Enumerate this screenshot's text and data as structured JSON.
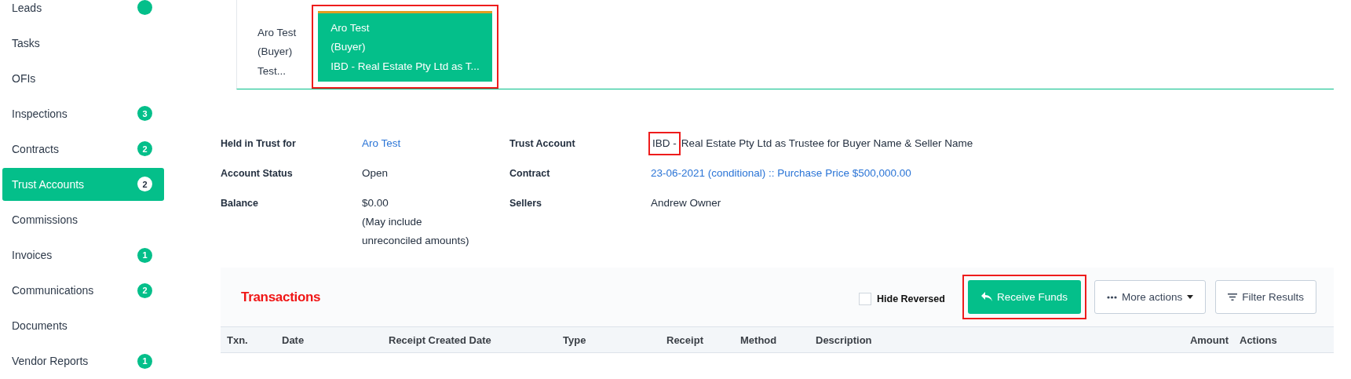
{
  "sidebar": {
    "items": [
      {
        "label": "Leads",
        "selected": false,
        "badge_cut": true
      },
      {
        "label": "Tasks",
        "selected": false
      },
      {
        "label": "OFIs",
        "selected": false
      },
      {
        "label": "Inspections",
        "selected": false,
        "badge": "3"
      },
      {
        "label": "Contracts",
        "selected": false,
        "badge": "2"
      },
      {
        "label": "Trust Accounts",
        "selected": true,
        "badge": "2"
      },
      {
        "label": "Commissions",
        "selected": false
      },
      {
        "label": "Invoices",
        "selected": false,
        "badge": "1"
      },
      {
        "label": "Communications",
        "selected": false,
        "badge": "2"
      },
      {
        "label": "Documents",
        "selected": false
      },
      {
        "label": "Vendor Reports",
        "selected": false,
        "badge": "1"
      }
    ]
  },
  "account_tabs": [
    {
      "lines": [
        "Aro Test",
        "(Buyer)",
        "Test..."
      ],
      "selected": false,
      "highlighted": false
    },
    {
      "lines": [
        "Aro Test",
        "(Buyer)",
        "IBD - Real Estate Pty Ltd as T..."
      ],
      "selected": true,
      "highlighted": true
    }
  ],
  "details": [
    {
      "label": "Held in Trust for",
      "kind": "link",
      "lines": [
        "Aro Test"
      ]
    },
    {
      "label": "Trust Account",
      "kind": "account",
      "prefix": "IBD -",
      "lines": [
        "Real Estate Pty Ltd as Trustee for Buyer Name & Seller Name"
      ],
      "highlighted": true
    },
    {
      "label": "Account Status",
      "kind": "text",
      "lines": [
        "Open"
      ]
    },
    {
      "label": "Contract",
      "kind": "link",
      "lines": [
        "23-06-2021 (conditional) :: Purchase Price $500,000.00"
      ]
    },
    {
      "label": "Balance",
      "kind": "text",
      "lines": [
        "$0.00",
        "(May include",
        "unreconciled amounts)"
      ]
    },
    {
      "label": "Sellers",
      "kind": "text",
      "lines": [
        "Andrew Owner"
      ]
    }
  ],
  "transactions": {
    "title": "Transactions",
    "hide_reversed": {
      "label": "Hide Reversed",
      "checked": false
    },
    "receive_button": {
      "label": "Receive Funds",
      "highlighted": true
    },
    "more_button": {
      "label": "More actions"
    },
    "filter_button": {
      "label": "Filter Results"
    },
    "columns": [
      "Txn.",
      "Date",
      "Receipt Created Date",
      "Type",
      "Receipt",
      "Method",
      "Description",
      "Amount",
      "Actions"
    ]
  }
}
